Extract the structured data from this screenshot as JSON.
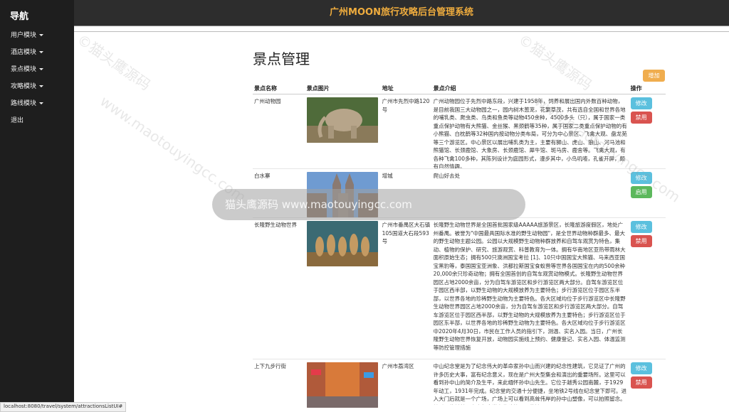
{
  "sidebar": {
    "brand": "导航",
    "items": [
      {
        "label": "用户模块",
        "dropdown": true
      },
      {
        "label": "酒店模块",
        "dropdown": true
      },
      {
        "label": "景点模块",
        "dropdown": true
      },
      {
        "label": "攻略模块",
        "dropdown": true
      },
      {
        "label": "路线模块",
        "dropdown": true
      },
      {
        "label": "退出",
        "dropdown": false
      }
    ]
  },
  "header": {
    "title": "广州MOON旅行攻略后台管理系统",
    "title_color": "#f0ad3e"
  },
  "main": {
    "page_title": "景点管理",
    "add_label": "增加",
    "columns": [
      "景点名称",
      "景点图片",
      "地址",
      "景点介绍",
      "操作"
    ],
    "rows": [
      {
        "name": "广州动物园",
        "image": "elephant-statue",
        "address": "广州市先烈中路120号",
        "description": "广州动物园位于先烈中路东段，兴建于1958年，饲养和展出国内外数百种动物，是目前我国三大动物园之一，园内树木葱茏，花繁草茂，共有选自全国和世界各地的哺乳类、爬虫类、鸟类和鱼类等动物450余种，4500多头（只），属于国家一类重点保护动物有大熊猫、金丝猴、黑颈鹤等35种，属于国家二类重点保护动物的有小熊猫、白枕鹤等32种国内按动物分类布局，可分为中心景区、飞禽大观、盘龙苑等三个游览区。中心景区以展出哺乳类为主，主要有狮山、虎山、狼山、河马池和熊猫馆、长颈鹿馆、大象房、长颈鹿馆、犀牛馆、斑马房、鹿舍等。飞禽大观，有各种飞禽100多种，其陈列设计为庭园形式，漫步其中，小鸟叽喳，孔雀开屏，颇有自然情趣。",
        "ops": [
          "修改",
          "禁用"
        ]
      },
      {
        "name": "白水寨",
        "image": "cathedral",
        "address": "增城",
        "description": "爬山好去处",
        "ops": [
          "修改",
          "启用"
        ]
      },
      {
        "name": "长隆野生动物世界",
        "image": "meerkats",
        "address": "广州市番禺区大石镇105国道大石段593号",
        "description": "长隆野生动物世界是全国首批国家级AAAAA旅游景区，长隆旅游度假区，地处广州番禺。被誉为\"中国最具国际水准的野生动物园\"，是全世界动物种群最多、最大的野生动物主题公园。公园以大规模野生动物种群放养和自驾车观赏为特色，集动、植物的保护、研究、旅游观赏、科普教育为一体。拥有华南地区亚热带雨林大面积原始生态；拥有500只澳洲国宝考拉 [1]、10只中国国宝大熊猫、马来西亚国宝黑豹等，泰国国宝亚洲象、洪都拉斯国宝食蚁兽等世界各国国宝在内的500余种20,000余只珍奇动物；拥有全国首创的自驾车观赏动物模式。长隆野生动物世界园区占地2000余亩，分为自驾车游览区和步行游览区两大部分。自驾车游览区位于园区西半部，以野生动物的大规模放养为主要特色；步行游览区位于园区东半部，以世界各地的珍稀野生动物为主要特色。各大区域均位于步行游览区中长隆野生动物世界园区占地2000余亩，分为自驾车游览区和步行游览区两大部分。自驾车游览区位于园区西半部，以野生动物的大规模放养为主要特色；步行游览区位于园区东半部，以世界各地的珍稀野生动物为主要特色。各大区域均位于步行游览区中2020年4月30日，市民在工作人员的指引下，测温、实名入园。当日，广州长隆野生动物世界恢复开放，动物园实施线上预约、健康登记、实名入园、体温监测等防控管理措施",
        "ops": [
          "修改",
          "禁用"
        ]
      },
      {
        "name": "上下九步行街",
        "image": "pedestrian-street",
        "address": "广州市荔湾区",
        "description": "中山纪念堂是为了纪念伟大的革命家孙中山而兴建的纪念性建筑，它见证了广州的许多历史大事，富有纪念意义，现在是广州大型集会和演出的重要场所。这里可以看到孙中山的简介及生平，来此缅怀孙中山先生。它位于越秀公园南麓，于1929年动工，1931年完成。纪念堂的交通十分便捷，坐地铁2号线在纪念堂下即可。进入大门后就是一个广场，广场上可以看到高耸伟岸的孙中山塑像，可以拍照留念。然后再往前就是中山纪念堂主体建筑了，落地",
        "ops": [
          "修改",
          "禁用"
        ]
      }
    ]
  },
  "watermark": {
    "bar_text": "猫头鹰源码 www.maotouyingcc.com",
    "diag_texts": [
      "©猫头鹰源码",
      "www.maotouyingcc.com"
    ]
  },
  "statusbar": {
    "url": "localhost:8080/travel/system/attractionsListUI#"
  }
}
